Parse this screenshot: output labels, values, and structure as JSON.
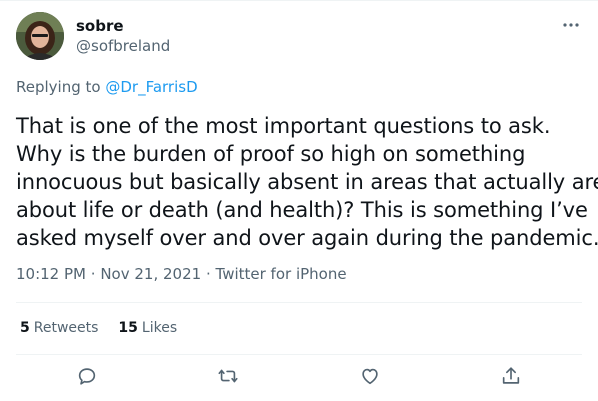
{
  "user": {
    "display_name": "sobre",
    "handle": "@sofbreland",
    "avatar_icon": "profile-photo"
  },
  "reply": {
    "prefix": "Replying to",
    "mention": "@Dr_FarrisD"
  },
  "tweet": {
    "lines": [
      "That is one of the most important questions to ask.",
      "Why is the burden of proof so high on something",
      "innocuous but basically absent in areas that actually are",
      "about life or death (and health)? This is something I’ve",
      "asked myself over and over again during the pandemic."
    ]
  },
  "meta": {
    "time": "10:12 PM",
    "separator1": "·",
    "date": "Nov 21, 2021",
    "separator2": "·",
    "source": "Twitter for iPhone"
  },
  "stats": {
    "retweets_count": "5",
    "retweets_label": "Retweets",
    "likes_count": "15",
    "likes_label": "Likes"
  },
  "actions": {
    "icons": [
      "reply-icon",
      "retweet-icon",
      "like-icon",
      "share-icon"
    ],
    "icon_color": "#536471"
  },
  "colors": {
    "link": "#1d9bf0",
    "secondary_text": "#536471",
    "primary_text": "#0f1419",
    "divider": "#eff3f4"
  }
}
